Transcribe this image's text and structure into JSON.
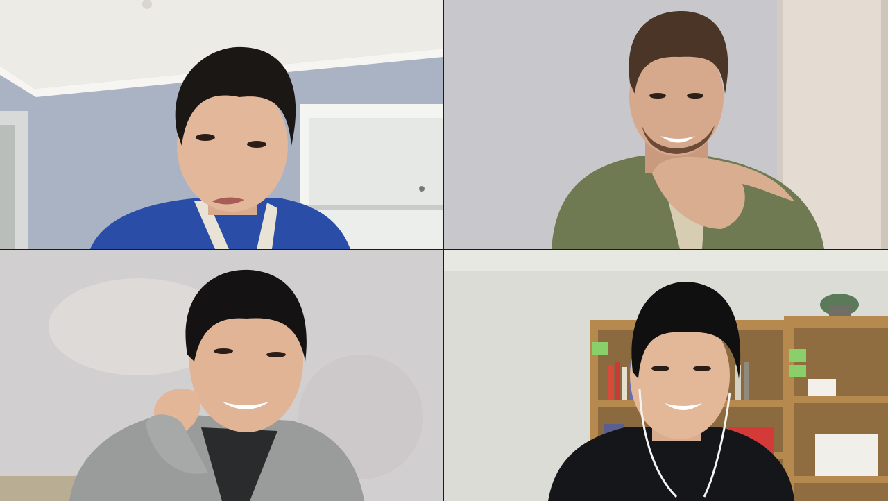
{
  "window": {
    "layout": "gallery-2x2"
  },
  "participants": [
    {
      "id": "participant-1",
      "position": "top-left",
      "scene": {
        "wall": "#a9b3c4",
        "ceiling": "#ecebe6",
        "shirt": "#2a4ea8",
        "hair": "#1a1715",
        "skin": "#e3b79a"
      }
    },
    {
      "id": "participant-2",
      "position": "top-right",
      "scene": {
        "wall": "#c8c8cc",
        "side_wall": "#e4dcd2",
        "shirt": "#6f7a52",
        "hair": "#4a3526",
        "skin": "#d6a98c"
      }
    },
    {
      "id": "participant-3",
      "position": "bottom-left",
      "scene": {
        "wall": "#d2cfd0",
        "shirt": "#9a9c9b",
        "hair": "#141212",
        "skin": "#e0b495"
      }
    },
    {
      "id": "participant-4",
      "position": "bottom-right",
      "scene": {
        "wall": "#dcdcd6",
        "shelf": "#b6894f",
        "shirt": "#15161a",
        "hair": "#101010",
        "skin": "#e2b899"
      }
    }
  ]
}
